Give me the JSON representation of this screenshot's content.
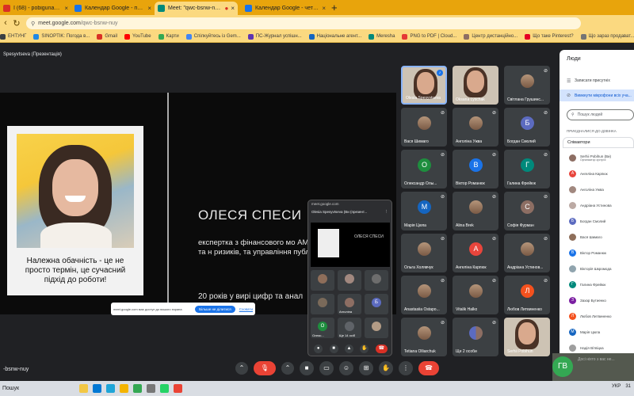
{
  "browser": {
    "tabs": [
      {
        "label": "ї (68) - pobigunang@g...",
        "color": "#d93025",
        "active": false
      },
      {
        "label": "Календар Google - понеділок",
        "color": "#1a73e8",
        "active": false
      },
      {
        "label": "Meet: \"qwc-bsnw-nuy\"",
        "color": "#00897b",
        "active": true
      },
      {
        "label": "Календар Google - четвер, 3 с",
        "color": "#1a73e8",
        "active": false
      }
    ],
    "new_tab_label": "+",
    "url_host": "meet.google.com",
    "url_path": "/qwc-bsnw-nuy",
    "bookmarks": [
      {
        "label": "ЕНТУНГ",
        "color": "#3c4043"
      },
      {
        "label": "SINOPTIK: Погода в...",
        "color": "#1e88e5"
      },
      {
        "label": "Gmail",
        "color": "#d93025"
      },
      {
        "label": "YouTube",
        "color": "#ff0000"
      },
      {
        "label": "Карти",
        "color": "#34a853"
      },
      {
        "label": "Спілкуйтесь із Gem...",
        "color": "#4285f4"
      },
      {
        "label": "ПС-Журнал успішн...",
        "color": "#5e35b1"
      },
      {
        "label": "Національне агент...",
        "color": "#1565c0"
      },
      {
        "label": "Mereshа",
        "color": "#00897b"
      },
      {
        "label": "PNG to PDF | Cloud...",
        "color": "#e53935"
      },
      {
        "label": "Центр дистанційно...",
        "color": "#8d6e63"
      },
      {
        "label": "Що таке Pinterest?",
        "color": "#e60023"
      },
      {
        "label": "Що зараз продават...",
        "color": "#757575"
      }
    ]
  },
  "meet": {
    "presenter_label": "Spesyvtseva (Презентація)",
    "meeting_code": "-bsnw-nuy",
    "slide": {
      "quote": "Належна обачність - це не просто термін, це сучасний підхід до роботи!",
      "name": "ОЛЕСЯ СПЕСИ",
      "bio": "експертка з фінансового мо AML, оцінки фінансових та н ризиків, та управління публ фінансами.",
      "years": "20 років у вирі цифр та анал"
    },
    "share_notice": {
      "text": "meet.google.com має доступ до вашого екрана",
      "stop_label": "Більше не ділитися",
      "hide_label": "Сховати"
    },
    "pip": {
      "url": "meet.google.com",
      "title": "Olesia Spesyvtseva (Ви (презент...",
      "slide_title": "ОЛЕСЯ СПЕСИ",
      "tiles": [
        {
          "label": "",
          "initial": "",
          "color": "#8e6e5a"
        },
        {
          "label": "",
          "initial": "",
          "color": "#a1887f"
        },
        {
          "label": "",
          "initial": "",
          "color": "#6d6d6d"
        },
        {
          "label": "",
          "initial": "",
          "color": "#7a6a5a"
        },
        {
          "label": "Анголіна",
          "initial": "",
          "color": "#8d6e63"
        },
        {
          "label": "",
          "initial": "Б",
          "color": "#5c6bc0"
        },
        {
          "label": "Олекс...",
          "initial": "О",
          "color": "#1e8e3e"
        },
        {
          "label": "Ще 14 осіб",
          "initial": "",
          "color": "#5f6368"
        },
        {
          "label": "",
          "initial": "",
          "color": "#b39c86"
        }
      ]
    },
    "participants": [
      {
        "name": "Olesia Spesyvtseva",
        "type": "video",
        "speaking": true
      },
      {
        "name": "Oksana Lyschak",
        "type": "video",
        "speaking": false
      },
      {
        "name": "Світлана Грушинс...",
        "type": "photo",
        "initial": "",
        "color": ""
      },
      {
        "name": "Вася Шимаго",
        "type": "photo",
        "initial": "",
        "color": ""
      },
      {
        "name": "Анголіна Ужва",
        "type": "photo",
        "initial": "",
        "color": ""
      },
      {
        "name": "Богдан Смолий",
        "type": "initial",
        "initial": "Б",
        "color": "#5c6bc0"
      },
      {
        "name": "Олександр Олы...",
        "type": "initial",
        "initial": "О",
        "color": "#1e8e3e"
      },
      {
        "name": "Віктор Романюк",
        "type": "initial",
        "initial": "В",
        "color": "#1a73e8"
      },
      {
        "name": "Галина Фрейюк",
        "type": "initial",
        "initial": "Г",
        "color": "#00897b"
      },
      {
        "name": "Марія Цюпа",
        "type": "initial",
        "initial": "М",
        "color": "#1565c0"
      },
      {
        "name": "Alina Brek",
        "type": "photo",
        "initial": "",
        "color": ""
      },
      {
        "name": "Софія Фурман",
        "type": "initial",
        "initial": "С",
        "color": "#8d6e63"
      },
      {
        "name": "Ольга Холявчук",
        "type": "photo",
        "initial": "",
        "color": ""
      },
      {
        "name": "Ангеліна Карпюк",
        "type": "initial",
        "initial": "А",
        "color": "#e8453c"
      },
      {
        "name": "Андріана Устинов...",
        "type": "photo",
        "initial": "",
        "color": ""
      },
      {
        "name": "Anastasiia Ostapo...",
        "type": "photo",
        "initial": "",
        "color": ""
      },
      {
        "name": "Vitalik Halko",
        "type": "photo",
        "initial": "",
        "color": ""
      },
      {
        "name": "Любов Литвиненко",
        "type": "initial",
        "initial": "Л",
        "color": "#f4511e"
      },
      {
        "name": "Tetiana Olliarchuk",
        "type": "photo",
        "initial": "",
        "color": ""
      },
      {
        "name": "Ще 2 особи",
        "type": "initial",
        "initial": "",
        "color": ""
      },
      {
        "name": "Serhii Pobihun",
        "type": "video",
        "speaking": false
      }
    ],
    "controls": [
      "mic-off",
      "cam",
      "present",
      "cc",
      "emoji",
      "share",
      "hand",
      "more",
      "end"
    ]
  },
  "people_panel": {
    "title": "Люди",
    "record_attendance": "Записати присутніх",
    "remove_mics": "Вимкнути мікрофони всіх уча...",
    "search_placeholder": "Пошук людей",
    "section_label": "ПРИЄДНАЛИСЯ ДО ДЗВІНКА",
    "group_label": "Співавтори",
    "people": [
      {
        "name": "Serhii Pobihun (Ви)",
        "sub": "Організатор зустрічі",
        "initial": "",
        "color": "#8d6e63"
      },
      {
        "name": "Ангеліна Карпюк",
        "sub": "",
        "initial": "А",
        "color": "#e8453c"
      },
      {
        "name": "Анголіна Ужва",
        "sub": "",
        "initial": "",
        "color": "#a1887f"
      },
      {
        "name": "Андріана Устинова",
        "sub": "",
        "initial": "",
        "color": "#bcaaa4"
      },
      {
        "name": "Богдан Смолий",
        "sub": "",
        "initial": "Б",
        "color": "#5c6bc0"
      },
      {
        "name": "Вася Шимаго",
        "sub": "",
        "initial": "",
        "color": "#8e6e5a"
      },
      {
        "name": "Віктор Романюк",
        "sub": "",
        "initial": "В",
        "color": "#1a73e8"
      },
      {
        "name": "Вікторія Шкромода",
        "sub": "",
        "initial": "",
        "color": "#90a4ae"
      },
      {
        "name": "Галина Фрейюк",
        "sub": "",
        "initial": "Г",
        "color": "#00897b"
      },
      {
        "name": "Захар Бутиенко",
        "sub": "",
        "initial": "З",
        "color": "#7b1fa2"
      },
      {
        "name": "Любов Литвиненко",
        "sub": "",
        "initial": "Л",
        "color": "#f4511e"
      },
      {
        "name": "Марія Цюпа",
        "sub": "",
        "initial": "М",
        "color": "#1565c0"
      },
      {
        "name": "Надія Вітвіцка",
        "sub": "",
        "initial": "",
        "color": "#9e9e9e"
      }
    ],
    "self_initials": "ГВ",
    "self_hint": "Досі ніхто з вас не..."
  },
  "taskbar": {
    "search_label": "Пошук",
    "tray_lang": "УКР",
    "tray_time": "31"
  }
}
